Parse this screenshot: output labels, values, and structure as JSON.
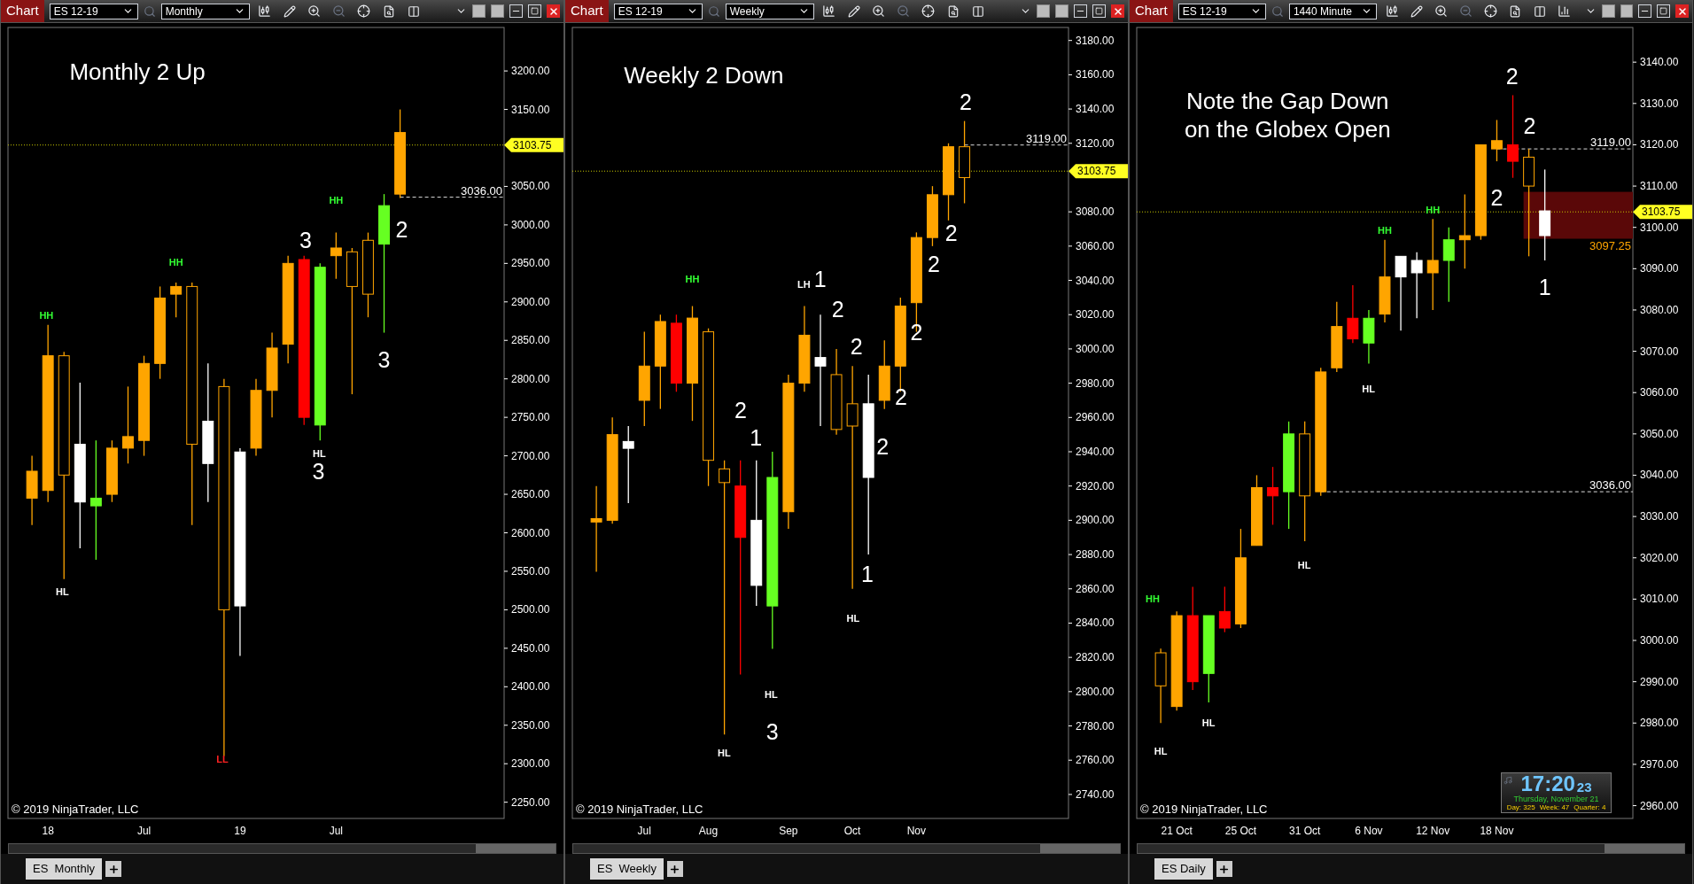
{
  "panels": [
    {
      "toolbar": {
        "app_label": "Chart",
        "instrument": "ES 12-19",
        "interval": "Monthly",
        "extra_tool": false
      },
      "note": "Monthly 2 Up",
      "chart_data": {
        "type": "candlestick",
        "ylim": [
          2228.9,
          3256.5
        ],
        "categories": [
          null,
          null,
          "18",
          null,
          null,
          null,
          null,
          null,
          "Jul",
          null,
          null,
          null,
          null,
          null,
          "19",
          null,
          null,
          null,
          null,
          null,
          "Jul",
          null,
          null,
          null,
          null,
          null,
          null,
          null,
          null,
          null,
          null
        ],
        "ohlc": [
          null,
          [
            2645,
            2700,
            2610,
            2680
          ],
          [
            2655,
            2870,
            2640,
            2830
          ],
          [
            2830,
            2835,
            2540,
            2675
          ],
          [
            2640,
            2795,
            2580,
            2715
          ],
          [
            2635,
            2720,
            2565,
            2645
          ],
          [
            2650,
            2720,
            2640,
            2710
          ],
          [
            2710,
            2790,
            2690,
            2725
          ],
          [
            2720,
            2830,
            2700,
            2820
          ],
          [
            2820,
            2920,
            2800,
            2905
          ],
          [
            2910,
            2925,
            2880,
            2920
          ],
          [
            2920,
            2925,
            2610,
            2715
          ],
          [
            2690,
            2820,
            2640,
            2745
          ],
          [
            2790,
            2800,
            2310,
            2500
          ],
          [
            2505,
            2710,
            2440,
            2705
          ],
          [
            2710,
            2800,
            2700,
            2785
          ],
          [
            2785,
            2860,
            2750,
            2840
          ],
          [
            2845,
            2960,
            2820,
            2950
          ],
          [
            2955,
            2960,
            2740,
            2750
          ],
          [
            2740,
            2950,
            2720,
            2945
          ],
          [
            2960,
            2990,
            2930,
            2970
          ],
          [
            2965,
            2970,
            2780,
            2920
          ],
          [
            2980,
            2990,
            2880,
            2910
          ],
          [
            2975,
            3040,
            2860,
            3025
          ],
          [
            3040,
            3150,
            3035,
            3120
          ],
          null,
          null,
          null,
          null,
          null,
          null
        ],
        "colors": [
          null,
          "#ffa500",
          "#ffa500",
          "#ffa500",
          "#ffffff",
          "#66ff22",
          "#ffa500",
          "#ffa500",
          "#ffa500",
          "#ffa500",
          "#ffa500",
          "#ffa500",
          "#ffffff",
          "#ffa500",
          "#ffffff",
          "#ffa500",
          "#ffa500",
          "#ffa500",
          "#ff0000",
          "#66ff22",
          "#ffa500",
          "#ffa500",
          "#ffa500",
          "#66ff22",
          "#ffa500",
          null,
          null,
          null,
          null,
          null,
          null
        ],
        "yticks": [
          {
            "value": 3200,
            "label": "3200.00"
          },
          {
            "value": 3150,
            "label": "3150.00"
          },
          {
            "value": 3050,
            "label": "3050.00"
          },
          {
            "value": 3000,
            "label": "3000.00"
          },
          {
            "value": 2950,
            "label": "2950.00"
          },
          {
            "value": 2900,
            "label": "2900.00"
          },
          {
            "value": 2850,
            "label": "2850.00"
          },
          {
            "value": 2800,
            "label": "2800.00"
          },
          {
            "value": 2750,
            "label": "2750.00"
          },
          {
            "value": 2700,
            "label": "2700.00"
          },
          {
            "value": 2650,
            "label": "2650.00"
          },
          {
            "value": 2600,
            "label": "2600.00"
          },
          {
            "value": 2550,
            "label": "2550.00"
          },
          {
            "value": 2500,
            "label": "2500.00"
          },
          {
            "value": 2450,
            "label": "2450.00"
          },
          {
            "value": 2400,
            "label": "2400.00"
          },
          {
            "value": 2350,
            "label": "2350.00"
          },
          {
            "value": 2300,
            "label": "2300.00"
          },
          {
            "value": 2250,
            "label": "2250.00"
          }
        ],
        "ref_lines": [
          {
            "axis": "y",
            "value": 3103.75,
            "label": "3103.75"
          },
          {
            "axis": "y",
            "value": 3036,
            "label": "3036.00"
          }
        ],
        "annotations": [
          "HH",
          "HL",
          "HH",
          "3",
          "HL",
          "3",
          "HH",
          "2",
          "3",
          "LL"
        ]
      },
      "candle_hollow": [
        false,
        false,
        true,
        false,
        false,
        false,
        false,
        false,
        false,
        false,
        true,
        false,
        true,
        false,
        false,
        false,
        false,
        false,
        false,
        false,
        true,
        true,
        false,
        false
      ],
      "ref_line_styles": [
        {
          "kind": "last"
        },
        {
          "kind": "level"
        }
      ],
      "annotation_styles": [
        {
          "kind": "swing",
          "color": "#33ff33"
        },
        {
          "kind": "swing",
          "color": "#ffffff"
        },
        {
          "kind": "swing",
          "color": "#33ff33"
        },
        {
          "kind": "count"
        },
        {
          "kind": "swing",
          "color": "#ffffff"
        },
        {
          "kind": "count"
        },
        {
          "kind": "swing",
          "color": "#33ff33"
        },
        {
          "kind": "count"
        },
        {
          "kind": "count"
        },
        {
          "kind": "swing",
          "color": "#ff2222"
        }
      ],
      "copyright": "© 2019 NinjaTrader, LLC",
      "tab": {
        "label": "ES  Monthly",
        "selected": true
      }
    },
    {
      "toolbar": {
        "app_label": "Chart",
        "instrument": "ES 12-19",
        "interval": "Weekly",
        "extra_tool": false
      },
      "note": "Weekly 2 Down",
      "chart_data": {
        "type": "candlestick",
        "ylim": [
          2726,
          3187.6
        ],
        "categories": [
          null,
          null,
          null,
          null,
          "Jul",
          null,
          null,
          null,
          "Aug",
          null,
          null,
          null,
          null,
          "Sep",
          null,
          null,
          null,
          "Oct",
          null,
          null,
          null,
          "Nov",
          null,
          null,
          null,
          null,
          null,
          null,
          null,
          null,
          null
        ],
        "ohlc": [
          null,
          [
            2899,
            2920,
            2870,
            2901
          ],
          [
            2900,
            2960,
            2898,
            2950
          ],
          [
            2942,
            2955,
            2910,
            2946
          ],
          [
            2970,
            3010,
            2955,
            2990
          ],
          [
            2990,
            3020,
            2965,
            3016
          ],
          [
            3015,
            3020,
            2975,
            2980
          ],
          [
            2980,
            3025,
            2958,
            3018
          ],
          [
            3010,
            3012,
            2920,
            2935
          ],
          [
            2930,
            2935,
            2775,
            2922
          ],
          [
            2920,
            2935,
            2810,
            2890
          ],
          [
            2862,
            2935,
            2850,
            2900
          ],
          [
            2850,
            2940,
            2825,
            2925
          ],
          [
            2905,
            2985,
            2895,
            2980
          ],
          [
            2980,
            3025,
            2975,
            3008
          ],
          [
            2990,
            3020,
            2955,
            2995
          ],
          [
            2985,
            3000,
            2950,
            2953
          ],
          [
            2968,
            2990,
            2860,
            2955
          ],
          [
            2925,
            2985,
            2880,
            2968
          ],
          [
            2970,
            3005,
            2965,
            2990
          ],
          [
            2990,
            3030,
            2975,
            3025
          ],
          [
            3027,
            3068,
            3010,
            3065
          ],
          [
            3065,
            3095,
            3060,
            3090
          ],
          [
            3090,
            3120,
            3075,
            3118
          ],
          [
            3118,
            3133,
            3085,
            3100
          ],
          null,
          null,
          null,
          null,
          null,
          null
        ],
        "colors": [
          null,
          "#ffa500",
          "#ffa500",
          "#ffffff",
          "#ffa500",
          "#ffa500",
          "#ff0000",
          "#ffa500",
          "#ffa500",
          "#ffa500",
          "#ff0000",
          "#ffffff",
          "#66ff22",
          "#ffa500",
          "#ffa500",
          "#ffffff",
          "#ffa500",
          "#ffa500",
          "#ffffff",
          "#ffa500",
          "#ffa500",
          "#ffa500",
          "#ffa500",
          "#ffa500",
          "#ffa500",
          null,
          null,
          null,
          null,
          null,
          null
        ],
        "yticks": [
          {
            "value": 3180,
            "label": "3180.00"
          },
          {
            "value": 3160,
            "label": "3160.00"
          },
          {
            "value": 3140,
            "label": "3140.00"
          },
          {
            "value": 3120,
            "label": "3120.00"
          },
          {
            "value": 3080,
            "label": "3080.00"
          },
          {
            "value": 3060,
            "label": "3060.00"
          },
          {
            "value": 3040,
            "label": "3040.00"
          },
          {
            "value": 3020,
            "label": "3020.00"
          },
          {
            "value": 3000,
            "label": "3000.00"
          },
          {
            "value": 2980,
            "label": "2980.00"
          },
          {
            "value": 2960,
            "label": "2960.00"
          },
          {
            "value": 2940,
            "label": "2940.00"
          },
          {
            "value": 2920,
            "label": "2920.00"
          },
          {
            "value": 2900,
            "label": "2900.00"
          },
          {
            "value": 2880,
            "label": "2880.00"
          },
          {
            "value": 2860,
            "label": "2860.00"
          },
          {
            "value": 2840,
            "label": "2840.00"
          },
          {
            "value": 2820,
            "label": "2820.00"
          },
          {
            "value": 2800,
            "label": "2800.00"
          },
          {
            "value": 2780,
            "label": "2780.00"
          },
          {
            "value": 2760,
            "label": "2760.00"
          },
          {
            "value": 2740,
            "label": "2740.00"
          }
        ],
        "ref_lines": [
          {
            "axis": "y",
            "value": 3119,
            "label": "3119.00"
          },
          {
            "axis": "y",
            "value": 3103.75,
            "label": "3103.75"
          }
        ],
        "annotations": [
          "2",
          "2",
          "2",
          "2",
          "2",
          "2",
          "2",
          "2",
          "LH",
          "1",
          "1",
          "2",
          "1",
          "HL",
          "HH",
          "HL",
          "3",
          "HL"
        ]
      },
      "candle_hollow": [
        false,
        false,
        false,
        false,
        false,
        false,
        false,
        true,
        true,
        false,
        false,
        false,
        false,
        false,
        false,
        true,
        true,
        false,
        false,
        false,
        false,
        false,
        false,
        true
      ],
      "ref_line_styles": [
        {
          "kind": "level"
        },
        {
          "kind": "last"
        }
      ],
      "annotation_styles": [
        {
          "kind": "count"
        },
        {
          "kind": "count"
        },
        {
          "kind": "count"
        },
        {
          "kind": "count"
        },
        {
          "kind": "count"
        },
        {
          "kind": "count"
        },
        {
          "kind": "count"
        },
        {
          "kind": "count"
        },
        {
          "kind": "swing",
          "color": "#ffffff"
        },
        {
          "kind": "count"
        },
        {
          "kind": "count"
        },
        {
          "kind": "count"
        },
        {
          "kind": "count"
        },
        {
          "kind": "swing",
          "color": "#ffffff"
        },
        {
          "kind": "swing",
          "color": "#33ff33"
        },
        {
          "kind": "swing",
          "color": "#ffffff"
        },
        {
          "kind": "count"
        },
        {
          "kind": "swing",
          "color": "#ffffff"
        }
      ],
      "copyright": "© 2019 NinjaTrader, LLC",
      "tab": {
        "label": "ES  Weekly",
        "selected": true
      }
    },
    {
      "toolbar": {
        "app_label": "Chart",
        "instrument": "ES 12-19",
        "interval": "1440 Minute",
        "extra_tool": true
      },
      "note": "Note the Gap Down\non the Globex Open",
      "chart_data": {
        "type": "candlestick",
        "ylim": [
          2956.9,
          3148.4
        ],
        "categories": [
          null,
          null,
          "21 Oct",
          null,
          null,
          null,
          "25 Oct",
          null,
          null,
          null,
          "31 Oct",
          null,
          null,
          null,
          "6 Nov",
          null,
          null,
          null,
          "12 Nov",
          null,
          null,
          null,
          "18 Nov",
          null,
          null,
          null,
          null,
          null,
          null,
          null,
          null
        ],
        "ohlc": [
          null,
          [
            2997,
            2998,
            2980,
            2989
          ],
          [
            2984,
            3007,
            2983,
            3006
          ],
          [
            3006,
            3013,
            2988,
            2990
          ],
          [
            2992,
            3006,
            2985,
            3006
          ],
          [
            3007,
            3013,
            3002,
            3003
          ],
          [
            3004,
            3027,
            3003,
            3020
          ],
          [
            3023,
            3040,
            3023,
            3037
          ],
          [
            3037,
            3042,
            3028,
            3035
          ],
          [
            3036,
            3053,
            3027,
            3050
          ],
          [
            3050,
            3053,
            3024,
            3035
          ],
          [
            3036,
            3066,
            3035,
            3065
          ],
          [
            3066,
            3082,
            3065,
            3076
          ],
          [
            3078,
            3086,
            3072,
            3073
          ],
          [
            3072,
            3080,
            3067,
            3078
          ],
          [
            3079,
            3097,
            3077,
            3088
          ],
          [
            3088,
            3093,
            3075,
            3093
          ],
          [
            3089,
            3094,
            3078,
            3092
          ],
          [
            3089,
            3102,
            3080,
            3092
          ],
          [
            3092,
            3100,
            3082,
            3097
          ],
          [
            3097,
            3108,
            3090,
            3098
          ],
          [
            3098,
            3120,
            3097,
            3120
          ],
          [
            3119,
            3126,
            3116,
            3121
          ],
          [
            3120,
            3132,
            3112,
            3116
          ],
          [
            3117,
            3119,
            3093,
            3110
          ],
          [
            3104,
            3114,
            3092,
            3098
          ],
          null,
          null,
          null,
          null,
          null
        ],
        "colors": [
          null,
          "#ffa500",
          "#ffa500",
          "#ff0000",
          "#66ff22",
          "#ff0000",
          "#ffa500",
          "#ffa500",
          "#ff0000",
          "#66ff22",
          "#ffa500",
          "#ffa500",
          "#ffa500",
          "#ff0000",
          "#66ff22",
          "#ffa500",
          "#ffffff",
          "#ffffff",
          "#ffa500",
          "#66ff22",
          "#ffa500",
          "#ffa500",
          "#ffa500",
          "#ff0000",
          "#ffa500",
          "#ffffff",
          null,
          null,
          null,
          null,
          null
        ],
        "yticks": [
          {
            "value": 3140,
            "label": "3140.00"
          },
          {
            "value": 3130,
            "label": "3130.00"
          },
          {
            "value": 3120,
            "label": "3120.00"
          },
          {
            "value": 3110,
            "label": "3110.00"
          },
          {
            "value": 3100,
            "label": "3100.00"
          },
          {
            "value": 3090,
            "label": "3090.00"
          },
          {
            "value": 3080,
            "label": "3080.00"
          },
          {
            "value": 3070,
            "label": "3070.00"
          },
          {
            "value": 3060,
            "label": "3060.00"
          },
          {
            "value": 3050,
            "label": "3050.00"
          },
          {
            "value": 3040,
            "label": "3040.00"
          },
          {
            "value": 3030,
            "label": "3030.00"
          },
          {
            "value": 3020,
            "label": "3020.00"
          },
          {
            "value": 3010,
            "label": "3010.00"
          },
          {
            "value": 3000,
            "label": "3000.00"
          },
          {
            "value": 2990,
            "label": "2990.00"
          },
          {
            "value": 2980,
            "label": "2980.00"
          },
          {
            "value": 2970,
            "label": "2970.00"
          },
          {
            "value": 2960,
            "label": "2960.00"
          }
        ],
        "ref_lines": [
          {
            "axis": "y",
            "value": 3119,
            "label": "3119.00"
          },
          {
            "axis": "y",
            "value": 3103.75,
            "label": "3103.75"
          },
          {
            "axis": "y",
            "value": 3036,
            "label": "3036.00"
          }
        ],
        "bands": [
          {
            "axis": "y",
            "from": 3097.25,
            "to": 3108.6,
            "label": "3097.25"
          }
        ],
        "annotations": [
          "2",
          "2",
          "2",
          "1",
          "HH",
          "HH",
          "HH",
          "HL",
          "HL",
          "HL",
          "HL"
        ]
      },
      "candle_hollow": [
        true,
        false,
        false,
        false,
        false,
        false,
        false,
        false,
        false,
        true,
        false,
        false,
        false,
        false,
        false,
        false,
        false,
        false,
        false,
        false,
        false,
        false,
        false,
        true,
        false
      ],
      "ref_line_styles": [
        {
          "kind": "level"
        },
        {
          "kind": "last"
        },
        {
          "kind": "level"
        }
      ],
      "annotation_styles": [
        {
          "kind": "count"
        },
        {
          "kind": "count"
        },
        {
          "kind": "count"
        },
        {
          "kind": "count"
        },
        {
          "kind": "swing",
          "color": "#33ff33"
        },
        {
          "kind": "swing",
          "color": "#33ff33"
        },
        {
          "kind": "swing",
          "color": "#33ff33"
        },
        {
          "kind": "swing",
          "color": "#ffffff"
        },
        {
          "kind": "swing",
          "color": "#ffffff"
        },
        {
          "kind": "swing",
          "color": "#ffffff"
        },
        {
          "kind": "swing",
          "color": "#ffffff"
        }
      ],
      "copyright": "© 2019 NinjaTrader, LLC",
      "clock": {
        "time": "17:20",
        "seconds": "23",
        "date": "Thursday, November 21",
        "stats": [
          "Day: 325",
          "Week: 47",
          "Quarter: 4"
        ]
      },
      "tab": {
        "label": "ES Daily",
        "selected": true
      }
    }
  ]
}
